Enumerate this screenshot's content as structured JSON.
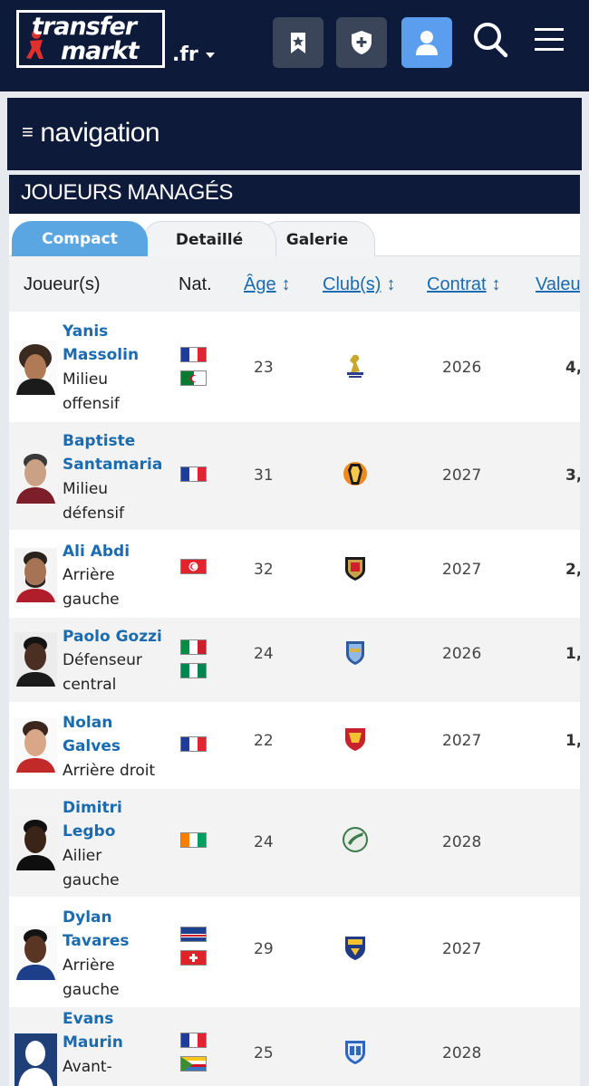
{
  "header": {
    "logo_line1": "transfer",
    "logo_line2": "markt",
    "domain": ".fr",
    "buttons": [
      "bookmark-star-icon",
      "shield-plus-icon",
      "user-icon",
      "search-icon",
      "menu-icon"
    ]
  },
  "nav": {
    "menu_glyph": "≡",
    "label": "navigation"
  },
  "section": {
    "title": "JOUEURS MANAGÉS"
  },
  "tabs": [
    "Compact",
    "Detaillé",
    "Galerie"
  ],
  "table": {
    "columns": {
      "player": "Joueur(s)",
      "nat": "Nat.",
      "age": "Âge",
      "club": "Club(s)",
      "contract": "Contrat",
      "value": "Valeur"
    },
    "sort_arrow": "↕",
    "rows": [
      {
        "first": "Yanis",
        "last": "Massolin",
        "pos1": "Milieu",
        "pos2": "offensif",
        "flags": [
          "france",
          "algeria"
        ],
        "age": "23",
        "contract": "2026",
        "value": "4,",
        "club_icon": "sc-bastia-crest-icon"
      },
      {
        "first": "Baptiste",
        "last": "Santamaria",
        "pos1": "Milieu",
        "pos2": "défensif",
        "flags": [
          "france"
        ],
        "age": "31",
        "contract": "2027",
        "value": "3,",
        "club_icon": "valencia-crest-icon"
      },
      {
        "first": "Ali Abdi",
        "last": "",
        "pos1": "Arrière",
        "pos2": "gauche",
        "flags": [
          "tunisia"
        ],
        "age": "32",
        "contract": "2027",
        "value": "2,",
        "club_icon": "ogc-nice-crest-icon"
      },
      {
        "first": "Paolo Gozzi",
        "last": "",
        "pos1": "Défenseur",
        "pos2": "central",
        "flags": [
          "italy",
          "nigeria"
        ],
        "age": "24",
        "contract": "2026",
        "value": "1,",
        "club_icon": "troyes-crest-icon"
      },
      {
        "first": "Nolan",
        "last": "Galves",
        "pos1": "Arrière droit",
        "pos2": "",
        "flags": [
          "france"
        ],
        "age": "22",
        "contract": "2027",
        "value": "1,",
        "club_icon": "rodez-crest-icon"
      },
      {
        "first": "Dimitri",
        "last": "Legbo",
        "pos1": "Ailier",
        "pos2": "gauche",
        "flags": [
          "ivory-coast"
        ],
        "age": "24",
        "contract": "2028",
        "value": "",
        "club_icon": "red-star-crest-icon"
      },
      {
        "first": "Dylan",
        "last": "Tavares",
        "pos1": "Arrière",
        "pos2": "gauche",
        "flags": [
          "cape-verde",
          "switzerland"
        ],
        "age": "29",
        "contract": "2027",
        "value": "",
        "club_icon": "sochaux-crest-icon"
      },
      {
        "first": "Evans",
        "last": "Maurin",
        "pos1": "Avant-",
        "pos2": "",
        "flags": [
          "france",
          "comoros"
        ],
        "age": "25",
        "contract": "2028",
        "value": "",
        "club_icon": "grenoble-crest-icon"
      }
    ]
  }
}
